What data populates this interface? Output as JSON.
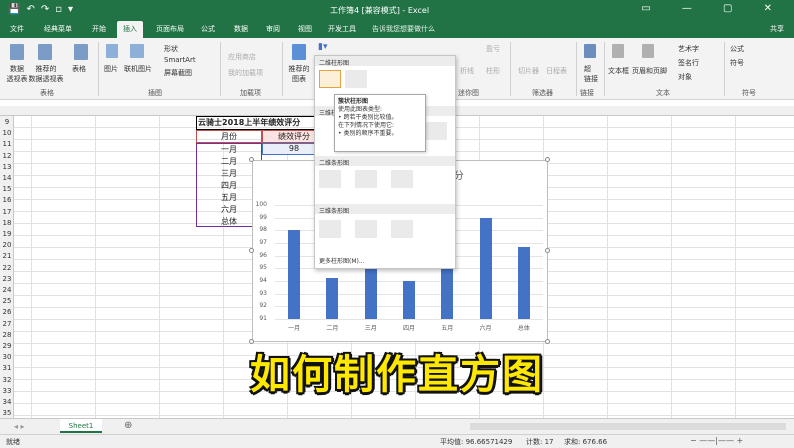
{
  "window": {
    "title": "工作簿4 [兼容模式] - Excel",
    "share": "共享"
  },
  "tabs": [
    "文件",
    "经典菜单",
    "开始",
    "插入",
    "页面布局",
    "公式",
    "数据",
    "审阅",
    "视图",
    "开发工具"
  ],
  "tell_me": "告诉我您想要做什么",
  "ribbon": {
    "pivot": "数据\n透视表",
    "rec_pivot": "推荐的\n数据透视表",
    "table": "表格",
    "pictures": "图片",
    "online_pictures": "联机图片",
    "shapes": "形状",
    "smartart": "SmartArt",
    "screenshot": "屏幕截图",
    "store": "应用商店",
    "my_addins": "我的加载项",
    "rec_charts": "推荐的\n图表",
    "pivotchart": "数据透视图",
    "line": "折线",
    "column": "柱形",
    "winloss": "盈亏",
    "slicer": "切片器",
    "timeline": "日程表",
    "link": "超\n链接",
    "textbox": "文本框",
    "header_footer": "页眉和页脚",
    "wordart": "艺术字",
    "signature": "签名行",
    "object": "对象",
    "equation": "公式",
    "symbol": "符号",
    "groups": [
      "表格",
      "插图",
      "加载项",
      "迷你图",
      "筛选器",
      "链接",
      "文本",
      "符号"
    ]
  },
  "sheet": {
    "rows": [
      "9",
      "10",
      "11",
      "12",
      "13",
      "14",
      "15",
      "16",
      "17",
      "18",
      "19",
      "20",
      "21",
      "22",
      "23",
      "24",
      "25",
      "26",
      "27",
      "28",
      "29",
      "30",
      "31",
      "32",
      "33",
      "34",
      "35"
    ],
    "table_title": "云骑士2018上半年绩效评分",
    "col_month": "月份",
    "col_score": "绩效评分",
    "months": [
      "一月",
      "二月",
      "三月",
      "四月",
      "五月",
      "六月",
      "总体"
    ],
    "first_score": "98"
  },
  "chart_data": {
    "type": "bar",
    "title": "云骑士2018上半年绩效评分",
    "categories": [
      "一月",
      "二月",
      "三月",
      "四月",
      "五月",
      "六月",
      "总体"
    ],
    "values": [
      98,
      94.2,
      95.2,
      94,
      96,
      99,
      96.7
    ],
    "ylim": [
      91,
      100
    ],
    "yticks": [
      "100",
      "99",
      "98",
      "97",
      "96",
      "95",
      "94",
      "93",
      "92",
      "91"
    ],
    "grid": true
  },
  "dropdown": {
    "h2d": "二维柱形图",
    "h3d": "三维柱形图",
    "hbar2d": "二维条形图",
    "hbar3d": "三维条形图",
    "more": "更多柱形图(M)..."
  },
  "tooltip": {
    "title": "簇状柱形图",
    "line1": "使用此图表类型:",
    "line2": "• 跨若干类别比较值。",
    "line3": "在下列情况下使用它:",
    "line4": "• 类别的顺序不重要。"
  },
  "caption": "如何制作直方图",
  "sheet_tab": "Sheet1",
  "status": {
    "ready": "就绪",
    "average": "平均值: 96.66571429",
    "count": "计数: 17",
    "sum": "求和: 676.66"
  }
}
